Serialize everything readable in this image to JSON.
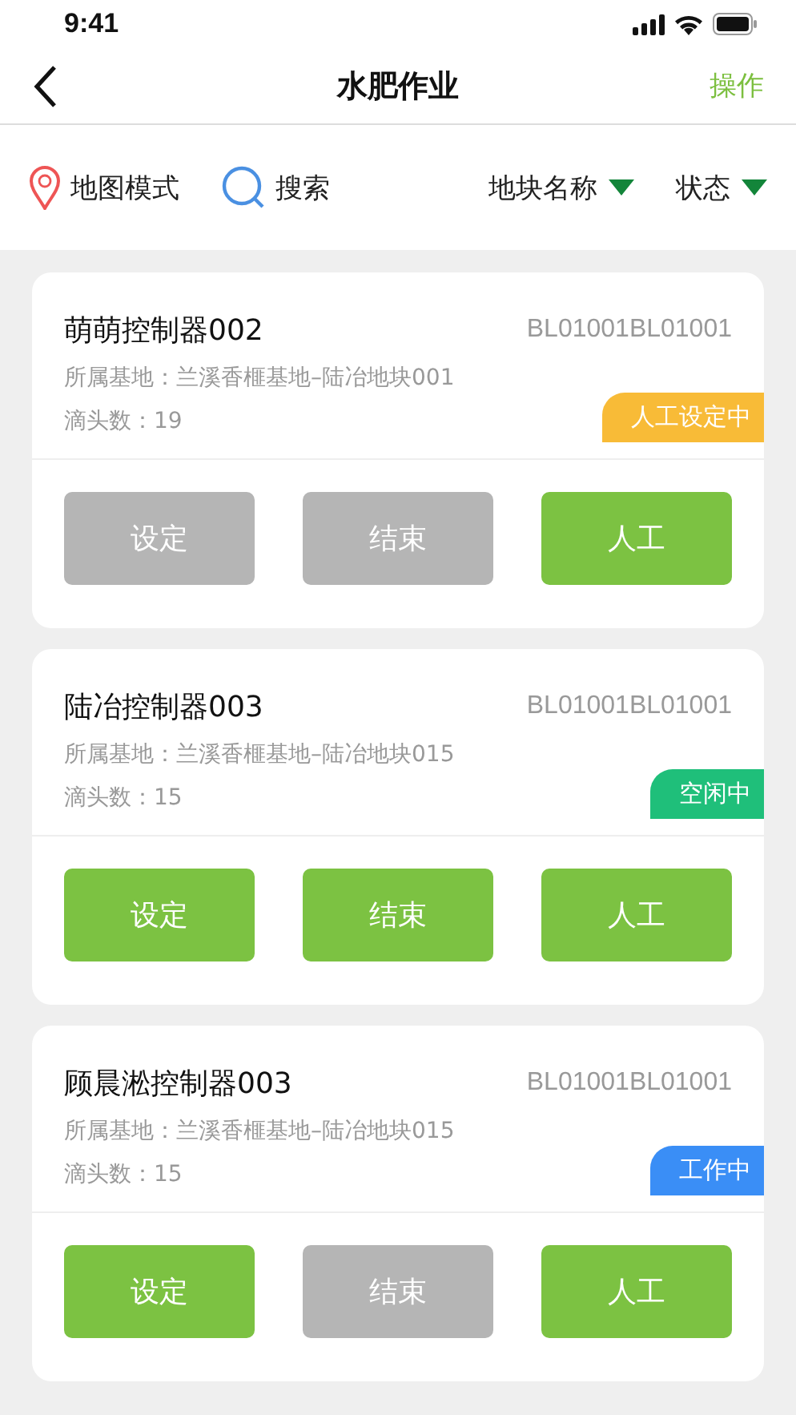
{
  "status_bar": {
    "time": "9:41"
  },
  "nav": {
    "title": "水肥作业",
    "action": "操作"
  },
  "filters": {
    "map_mode": "地图模式",
    "search": "搜索",
    "dropdowns": [
      "地块名称",
      "状态"
    ]
  },
  "controllers": [
    {
      "name": "萌萌控制器002",
      "code": "BL01001BL01001",
      "base": "所属基地：兰溪香榧基地–陆冶地块001",
      "drips": "滴头数：19",
      "status": "人工设定中",
      "color": "#f8bb37",
      "buttons": [
        {
          "label": "设定",
          "disabled": true
        },
        {
          "label": "结束",
          "disabled": true
        },
        {
          "label": "人工",
          "disabled": false
        }
      ]
    },
    {
      "name": "陆冶控制器003",
      "code": "BL01001BL01001",
      "base": "所属基地：兰溪香榧基地–陆冶地块015",
      "drips": "滴头数：15",
      "status": "空闲中",
      "color": "#1fbf7a",
      "buttons": [
        {
          "label": "设定",
          "disabled": false
        },
        {
          "label": "结束",
          "disabled": false
        },
        {
          "label": "人工",
          "disabled": false
        }
      ]
    },
    {
      "name": "顾晨淞控制器003",
      "code": "BL01001BL01001",
      "base": "所属基地：兰溪香榧基地–陆冶地块015",
      "drips": "滴头数：15",
      "status": "工作中",
      "color": "#3a8ef6",
      "buttons": [
        {
          "label": "设定",
          "disabled": false
        },
        {
          "label": "结束",
          "disabled": true
        },
        {
          "label": "人工",
          "disabled": false
        }
      ]
    }
  ]
}
